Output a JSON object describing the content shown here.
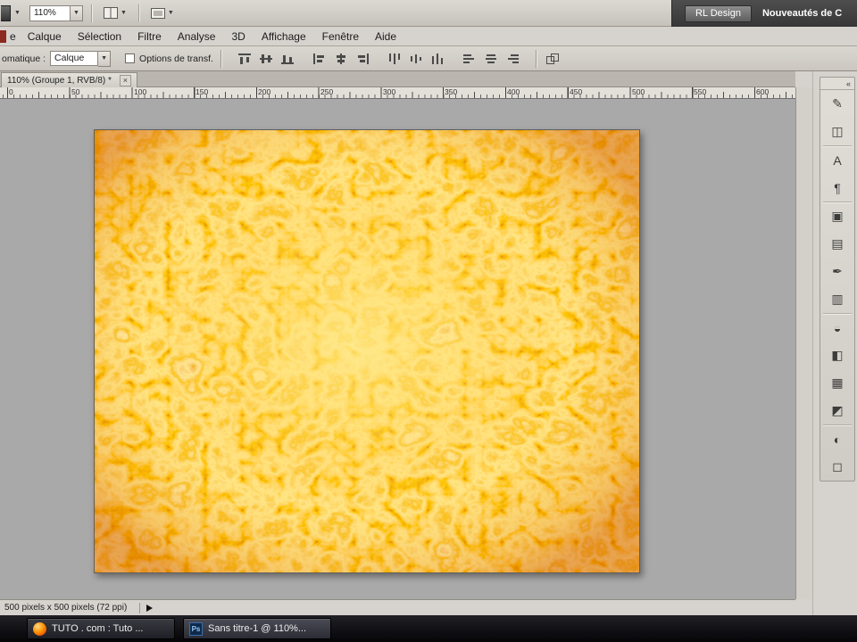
{
  "appbar": {
    "zoom_value": "110%",
    "workspace_button_label": "RL Design",
    "workspace_new_label": "Nouveautés de C"
  },
  "menubar": {
    "items": [
      "e",
      "Calque",
      "Sélection",
      "Filtre",
      "Analyse",
      "3D",
      "Affichage",
      "Fenêtre",
      "Aide"
    ]
  },
  "optionsbar": {
    "auto_select_label": "omatique :",
    "auto_select_value": "Calque",
    "show_transform_label": "Options de transf.",
    "align_icon_names": [
      "align-top-edges",
      "align-vertical-centers",
      "align-bottom-edges",
      "align-left-edges",
      "align-horizontal-centers",
      "align-right-edges",
      "distribute-top-edges",
      "distribute-vertical-centers",
      "distribute-bottom-edges",
      "distribute-left-edges",
      "distribute-horizontal-centers",
      "distribute-right-edges",
      "auto-align-layers"
    ]
  },
  "document": {
    "tab_title": "110% (Groupe 1, RVB/8) *",
    "close_glyph": "×"
  },
  "ruler": {
    "labels": [
      "0",
      "50",
      "100",
      "150",
      "200",
      "250",
      "300",
      "350",
      "400",
      "450",
      "500",
      "550",
      "600"
    ]
  },
  "canvas": {
    "palette": [
      "#c23a00",
      "#ff9a00",
      "#ffd84d",
      "#f59000",
      "#ffe468",
      "#e86a00",
      "#ffcf3f"
    ],
    "background": "#a9a9a9"
  },
  "statusbar": {
    "doc_size": "500 pixels x 500 pixels (72 ppi)"
  },
  "paneldock": {
    "collapse_glyph": "«",
    "icons": [
      {
        "name": "brushes-panel-icon",
        "glyph": "✎"
      },
      {
        "name": "clone-source-panel-icon",
        "glyph": "◫"
      },
      {
        "name": "character-panel-icon",
        "glyph": "A"
      },
      {
        "name": "paragraph-panel-icon",
        "glyph": "¶"
      },
      {
        "name": "layer-comps-panel-icon",
        "glyph": "▣"
      },
      {
        "name": "channels-panel-icon",
        "glyph": "▤"
      },
      {
        "name": "paths-panel-icon",
        "glyph": "✒"
      },
      {
        "name": "histogram-panel-icon",
        "glyph": "▥"
      },
      {
        "name": "info-panel-icon",
        "glyph": "◒"
      },
      {
        "name": "color-panel-icon",
        "glyph": "◧"
      },
      {
        "name": "swatches-panel-icon",
        "glyph": "▦"
      },
      {
        "name": "styles-panel-icon",
        "glyph": "◩"
      },
      {
        "name": "adjustments-panel-icon",
        "glyph": "◐"
      },
      {
        "name": "masks-panel-icon",
        "glyph": "◻"
      }
    ]
  },
  "taskbar": {
    "buttons": [
      {
        "label": "TUTO . com : Tuto ...",
        "icon": "firefox-icon"
      },
      {
        "label": "Sans titre-1 @ 110%...",
        "icon": "photoshop-icon",
        "icon_text": "Ps"
      }
    ]
  }
}
